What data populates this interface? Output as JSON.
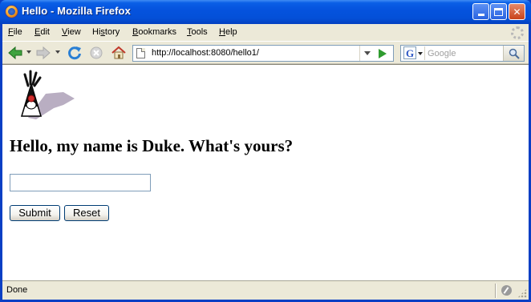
{
  "window": {
    "title": "Hello - Mozilla Firefox"
  },
  "menu": {
    "items": [
      {
        "label_ul": "F",
        "label_rest": "ile"
      },
      {
        "label_ul": "E",
        "label_rest": "dit"
      },
      {
        "label_ul": "V",
        "label_rest": "iew"
      },
      {
        "label_ul": "",
        "label_pre": "Hi",
        "label_ul2": "s",
        "label_rest": "tory"
      },
      {
        "label_ul": "B",
        "label_rest": "ookmarks"
      },
      {
        "label_ul": "T",
        "label_rest": "ools"
      },
      {
        "label_ul": "H",
        "label_rest": "elp"
      }
    ]
  },
  "nav": {
    "back_icon": "back-arrow-icon",
    "forward_icon": "forward-arrow-icon",
    "reload_icon": "reload-icon",
    "stop_icon": "stop-icon",
    "home_icon": "home-icon",
    "url": "http://localhost:8080/hello1/",
    "search_engine": "G",
    "search_placeholder": "Google"
  },
  "page": {
    "mascot": "duke-mascot",
    "heading": "Hello, my name is Duke. What's yours?",
    "input_value": "",
    "submit_label": "Submit",
    "reset_label": "Reset"
  },
  "status": {
    "text": "Done"
  },
  "colors": {
    "titlebar": "#0553de",
    "chrome": "#ece9d8",
    "field_border": "#7f9db9"
  }
}
